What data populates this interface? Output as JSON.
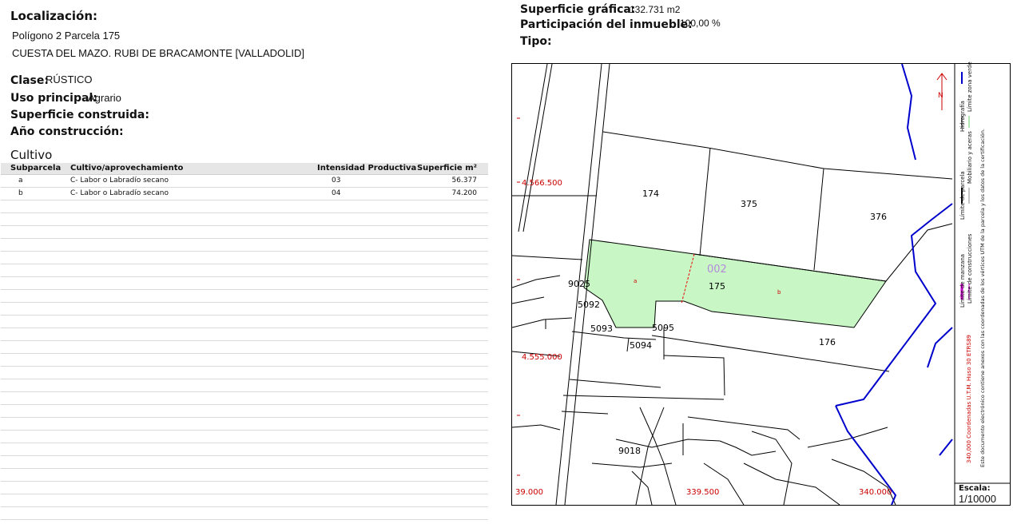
{
  "left": {
    "localizacion_label": "Localización:",
    "address_line1": "Polígono 2 Parcela 175",
    "address_line2": "CUESTA DEL MAZO. RUBI DE BRACAMONTE [VALLADOLID]",
    "clase_label": "Clase:",
    "clase_value": "RÚSTICO",
    "uso_label": "Uso principal:",
    "uso_value": "Agrario",
    "sup_construida_label": "Superficie construida:",
    "anio_label": "Año construcción:",
    "cultivo_title": "Cultivo"
  },
  "cultivo_table": {
    "headers": [
      "Subparcela",
      "Cultivo/aprovechamiento",
      "Intensidad Productiva",
      "Superficie m²"
    ],
    "rows": [
      [
        "a",
        "C- Labor o Labradío secano",
        "03",
        "56.377"
      ],
      [
        "b",
        "C- Labor o Labradío secano",
        "04",
        "74.200"
      ]
    ]
  },
  "right": {
    "sup_grafica_label": "Superficie gráfica:",
    "sup_grafica_value": "132.731 m2",
    "participacion_label": "Participación del inmueble:",
    "participacion_value": "100,00 %",
    "tipo_label": "Tipo:"
  },
  "map": {
    "parcels": [
      "174",
      "375",
      "376",
      "175",
      "176",
      "9025",
      "5092",
      "5093",
      "5095",
      "5094",
      "9018"
    ],
    "subparcels": [
      "a",
      "b"
    ],
    "building_code": "002",
    "coords_y": [
      "4.566.500",
      "4.555.000"
    ],
    "coords_x": [
      "39.000",
      "339.500",
      "340.000"
    ],
    "colors": {
      "parcel_fill": "#c8f7c5",
      "hydro": "#0000cc",
      "coord_red": "#cc0000",
      "code_purple": "#b48ad8"
    }
  },
  "legend": {
    "col1_a": "Límite de manzana",
    "col1_b": "Límite de parcela",
    "col1_c": "Hidrografía",
    "col2_a": "Límite de construcciones",
    "col2_b": "Mobiliario y aceras",
    "col2_c": "Límite zona verde",
    "utm": "340,000 Coordenadas U.T.M. Huso 30 ETRS89",
    "note": "Este documento electrónico contiene anexos con las coordenadas de los vértices UTM de la parcela y los datos de la certificación.",
    "escala_label": "Escala:",
    "escala_value": "1/10000"
  }
}
